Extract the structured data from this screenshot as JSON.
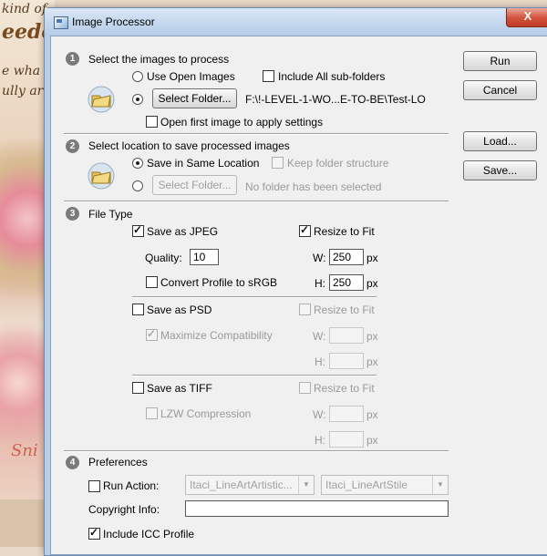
{
  "background": {
    "texts": [
      "kind of",
      "eede",
      "e wha",
      "ully ar",
      "Sni"
    ]
  },
  "window": {
    "title": "Image Processor",
    "close": "X"
  },
  "section1": {
    "num": "1",
    "heading": "Select the images to process",
    "use_open_images": "Use Open Images",
    "include_subfolders": "Include All sub-folders",
    "select_folder_btn": "Select Folder...",
    "folder_path": "F:\\!-LEVEL-1-WO...E-TO-BE\\Test-LO",
    "open_first_image": "Open first image to apply settings"
  },
  "section2": {
    "num": "2",
    "heading": "Select location to save processed images",
    "save_same_location": "Save in Same Location",
    "keep_folder_structure": "Keep folder structure",
    "select_folder_btn": "Select Folder...",
    "no_folder": "No folder has been selected"
  },
  "section3": {
    "num": "3",
    "heading": "File Type",
    "jpeg": {
      "save_as": "Save as JPEG",
      "resize": "Resize to Fit",
      "quality_label": "Quality:",
      "quality_value": "10",
      "w_label": "W:",
      "w_value": "250",
      "h_label": "H:",
      "h_value": "250",
      "unit": "px",
      "convert_profile": "Convert Profile to sRGB"
    },
    "psd": {
      "save_as": "Save as PSD",
      "resize": "Resize to Fit",
      "maximize": "Maximize Compatibility",
      "w_label": "W:",
      "h_label": "H:",
      "unit": "px"
    },
    "tiff": {
      "save_as": "Save as TIFF",
      "resize": "Resize to Fit",
      "lzw": "LZW Compression",
      "w_label": "W:",
      "h_label": "H:",
      "unit": "px"
    }
  },
  "section4": {
    "num": "4",
    "heading": "Preferences",
    "run_action": "Run Action:",
    "action_set": "Itaci_LineArtArtistic...",
    "action_name": "Itaci_LineArtStile",
    "copyright_label": "Copyright Info:",
    "copyright_value": "",
    "include_icc": "Include ICC Profile"
  },
  "buttons": {
    "run": "Run",
    "cancel": "Cancel",
    "load": "Load...",
    "save": "Save..."
  }
}
